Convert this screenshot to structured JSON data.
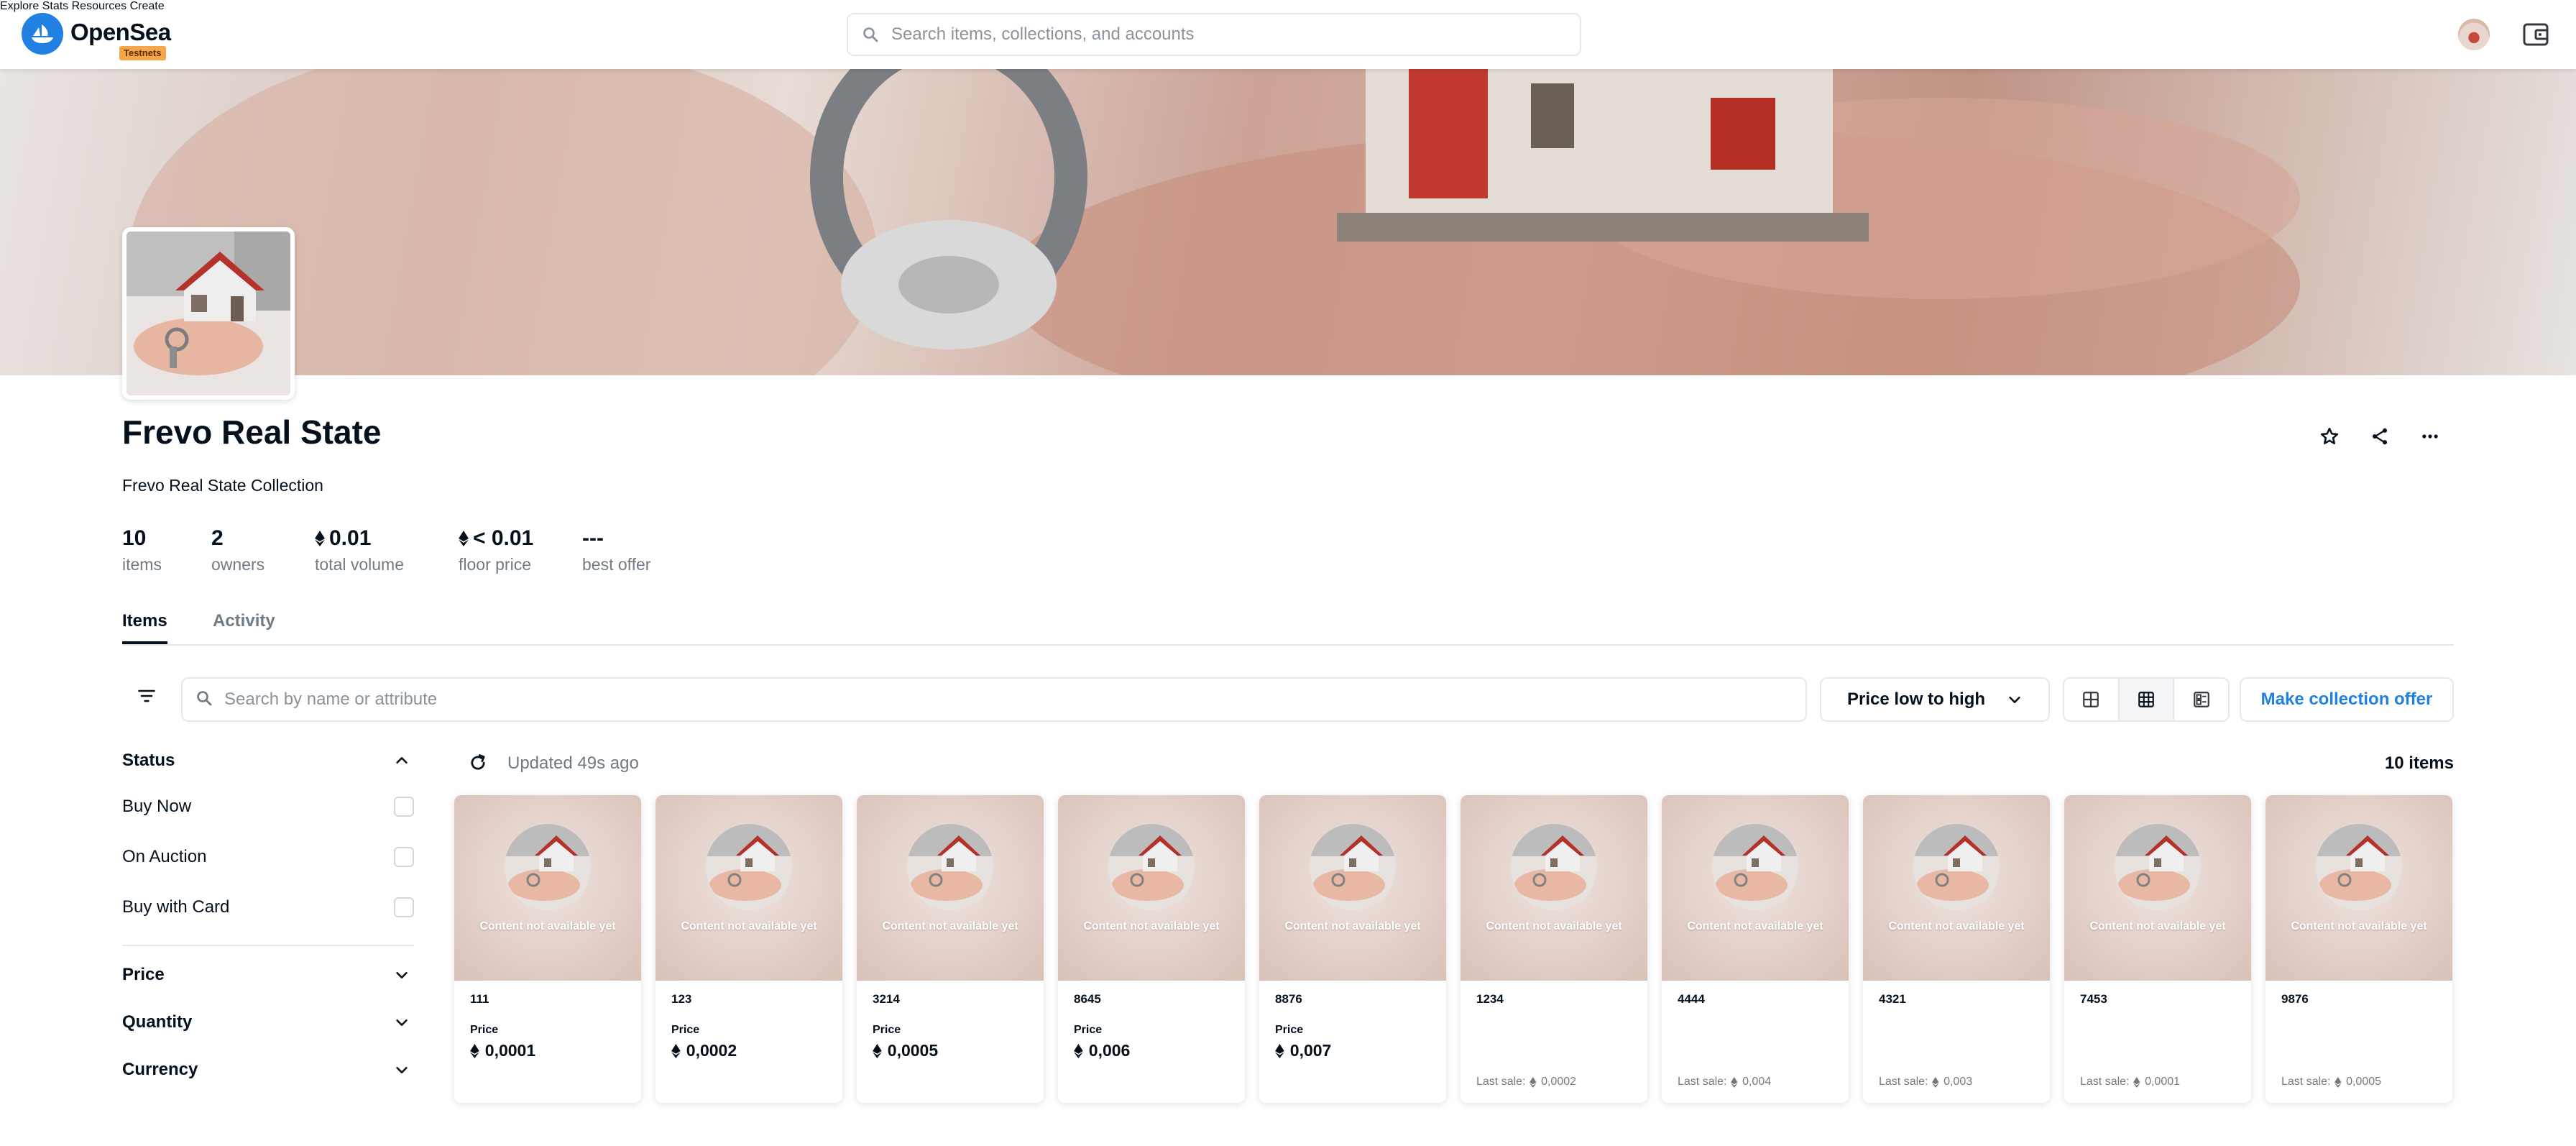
{
  "header": {
    "brand": "OpenSea",
    "badge": "Testnets",
    "search_placeholder": "Search items, collections, and accounts",
    "nav": [
      "Explore",
      "Stats",
      "Resources",
      "Create"
    ]
  },
  "collection": {
    "title": "Frevo Real State",
    "description": "Frevo Real State Collection",
    "stats": [
      {
        "value": "10",
        "label": "items"
      },
      {
        "value": "2",
        "label": "owners"
      },
      {
        "value": "0.01",
        "label": "total volume"
      },
      {
        "value": "< 0.01",
        "label": "floor price"
      },
      {
        "value": "---",
        "label": "best offer"
      }
    ]
  },
  "tabs": [
    "Items",
    "Activity"
  ],
  "filters": {
    "search_placeholder": "Search by name or attribute",
    "sort": "Price low to high",
    "offer_button": "Make collection offer"
  },
  "sidebar": {
    "status_title": "Status",
    "status_options": [
      "Buy Now",
      "On Auction",
      "Buy with Card"
    ],
    "sections": [
      "Price",
      "Quantity",
      "Currency"
    ]
  },
  "results": {
    "updated": "Updated 49s ago",
    "count": "10 items"
  },
  "cards": {
    "placeholder": "Content not available yet",
    "price_label": "Price",
    "last_sale_label": "Last sale:",
    "items": [
      {
        "name": "111",
        "price": "0,0001"
      },
      {
        "name": "123",
        "price": "0,0002"
      },
      {
        "name": "3214",
        "price": "0,0005"
      },
      {
        "name": "8645",
        "price": "0,006"
      },
      {
        "name": "8876",
        "price": "0,007"
      },
      {
        "name": "1234",
        "last_sale": "0,0002"
      },
      {
        "name": "4444",
        "last_sale": "0,004"
      },
      {
        "name": "4321",
        "last_sale": "0,003"
      },
      {
        "name": "7453",
        "last_sale": "0,0001"
      },
      {
        "name": "9876",
        "last_sale": "0,0005"
      }
    ]
  },
  "colors": {
    "accent": "#2081e2",
    "text": "#04111d",
    "muted": "#707a83",
    "border": "#e5e8eb"
  },
  "icons": [
    "opensea-logo-icon",
    "search-icon",
    "avatar",
    "wallet-icon",
    "star-icon",
    "share-icon",
    "more-icon",
    "filter-icon",
    "chevron-down-icon",
    "chevron-up-icon",
    "grid-large-icon",
    "grid-small-icon",
    "list-view-icon",
    "refresh-icon",
    "eth-icon"
  ]
}
